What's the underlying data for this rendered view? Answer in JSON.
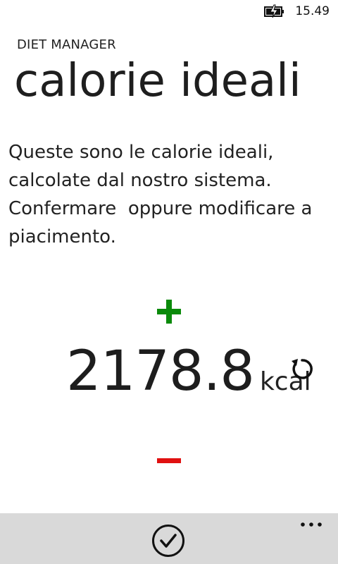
{
  "status_bar": {
    "time": "15.49",
    "battery_icon": "battery-charging-icon"
  },
  "app": {
    "name": "DIET MANAGER"
  },
  "page": {
    "title": "calorie ideali",
    "description_lines": [
      "Queste sono le calorie ideali,",
      "calcolate dal nostro sistema.",
      "Confermare  oppure modificare a",
      "piacimento."
    ]
  },
  "calories": {
    "value": "2178.8",
    "unit": "kcal"
  },
  "controls": {
    "increase_icon": "plus-icon",
    "decrease_icon": "minus-icon",
    "reset_icon": "refresh-icon",
    "increase_color": "#0a8a0a",
    "decrease_color": "#e01010"
  },
  "app_bar": {
    "confirm_icon": "check-circle-icon",
    "more_icon": "ellipsis-icon",
    "background": "#d9d9d9"
  }
}
